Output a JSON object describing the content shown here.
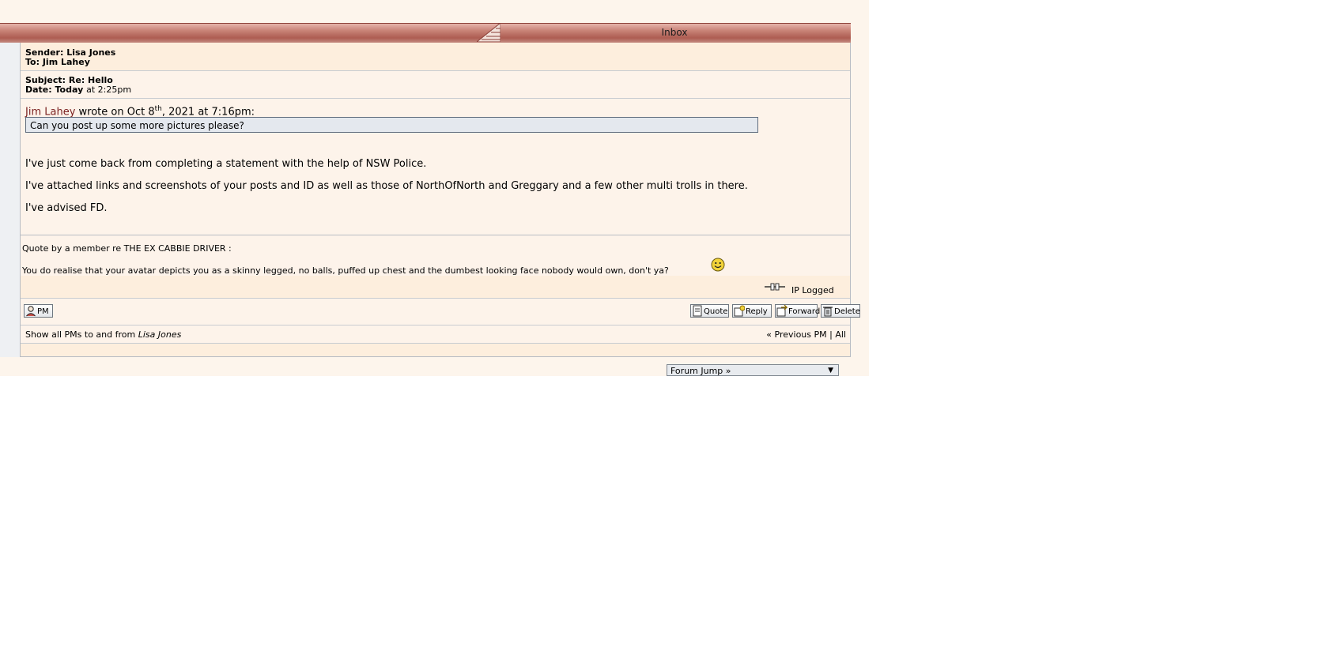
{
  "titlebar": {
    "title": "Inbox"
  },
  "message": {
    "sender_label": "Sender:",
    "sender": "Lisa Jones",
    "to_label": "To:",
    "to": "Jim Lahey",
    "subject_label": "Subject:",
    "subject": "Re: Hello",
    "date_label": "Date:",
    "date_bold": "Today",
    "date_rest": "at 2:25pm",
    "quote_author": "Jim Lahey",
    "quote_wrote": "wrote on Oct 8",
    "quote_sup": "th",
    "quote_tail": ", 2021 at 7:16pm:",
    "quote_text": "Can you post up some more pictures please?",
    "body": [
      "I've just come back from completing a statement with the help of NSW Police.",
      "I've attached links and screenshots of your posts and ID as well as those of NorthOfNorth and Greggary and a few other multi trolls in there.",
      "I've advised FD."
    ]
  },
  "signature": {
    "line1": "Quote by a member re THE EX CABBIE DRIVER :",
    "line2": "You do realise that your avatar depicts you as a skinny legged, no balls, puffed up chest and the dumbest looking face nobody would own, don't ya?",
    "smiley_icon": "smiley-icon"
  },
  "ip_logged": "IP Logged",
  "buttons": {
    "pm": "PM",
    "quote": "Quote",
    "reply": "Reply",
    "forward": "Forward",
    "delete": "Delete"
  },
  "nav": {
    "show_all_prefix": "Show all PMs to and from",
    "show_all_name": "Lisa Jones",
    "previous": "« Previous PM",
    "separator": "|",
    "all": "All"
  },
  "forum_jump": {
    "label": "Forum Jump »"
  },
  "colors": {
    "titlebar": "#ad5d52",
    "panel_bg": "#fdf3ea",
    "quote_bg": "#e4e8ee",
    "author_link": "#7a1f1f"
  }
}
